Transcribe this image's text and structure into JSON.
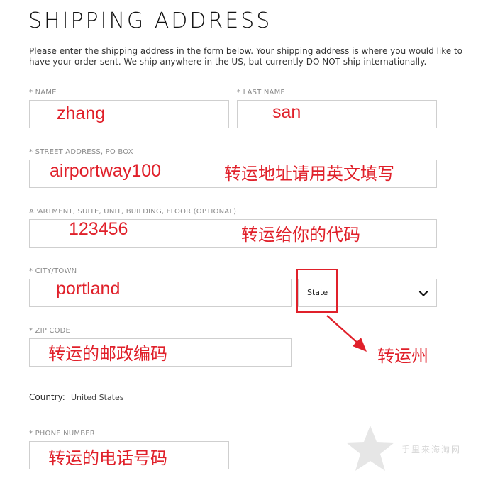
{
  "header": {
    "title": "SHIPPING ADDRESS",
    "intro": "Please enter the shipping address in the form below. Your shipping address is where you would like to have your order sent. We ship anywhere in the US, but currently DO NOT ship internationally."
  },
  "form": {
    "name": {
      "label": "* NAME",
      "value": "zhang"
    },
    "last_name": {
      "label": "* LAST NAME",
      "value": "san"
    },
    "street": {
      "label": "* STREET ADDRESS, PO BOX",
      "value": "airportway100",
      "note": "转运地址请用英文填写"
    },
    "apartment": {
      "label": "APARTMENT, SUITE, UNIT, BUILDING, FLOOR (OPTIONAL)",
      "value": "123456",
      "note": "转运给你的代码"
    },
    "city": {
      "label": "* CITY/TOWN",
      "value": "portland"
    },
    "state": {
      "selected": "State",
      "note": "转运州"
    },
    "zip": {
      "label": "* ZIP CODE",
      "note": "转运的邮政编码"
    },
    "country": {
      "label": "Country:",
      "value": "United States"
    },
    "phone": {
      "label": "* PHONE NUMBER",
      "note": "转运的电话号码"
    }
  },
  "watermark": {
    "text": "手里来海淘网"
  },
  "colors": {
    "annotation": "#e0202a",
    "field_border": "#cfcfcf",
    "label": "#8a8a8a"
  }
}
